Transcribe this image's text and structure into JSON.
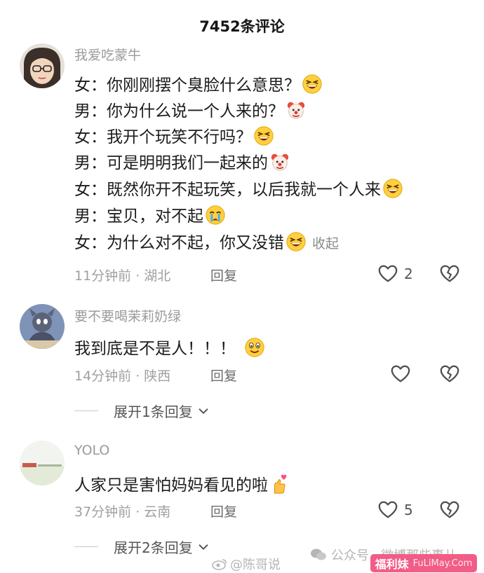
{
  "header": {
    "title": "7452条评论"
  },
  "comments": [
    {
      "username": "我爱吃蒙牛",
      "lines": [
        "女：你刚刚摆个臭脸什么意思？",
        "男：你为什么说一个人来的？",
        "女：我开个玩笑不行吗？",
        "男：可是明明我们一起来的",
        "女：既然你开不起玩笑，以后我就一个人来",
        "男：宝贝，对不起",
        "女：为什么对不起，你又没错"
      ],
      "collapse_label": "收起",
      "meta": "11分钟前 · 湖北",
      "reply_label": "回复",
      "like_count": "2"
    },
    {
      "username": "要不要喝茉莉奶绿",
      "lines": [
        "我到底是不是人！！！"
      ],
      "meta": "14分钟前 · 陕西",
      "reply_label": "回复",
      "expand_label": "展开1条回复"
    },
    {
      "username": "YOLO",
      "lines": [
        "人家只是害怕妈妈看见的啦"
      ],
      "meta": "37分钟前 · 云南",
      "reply_label": "回复",
      "like_count": "5",
      "expand_label": "展开2条回复"
    }
  ],
  "watermarks": {
    "weibo": "@陈哥说",
    "wechat": "公众号 · 微博那些事儿",
    "badge_cn": "福利妹",
    "badge_en": "FuLiMay.Com"
  },
  "icons": {
    "laugh": "grinning-squint-face-icon",
    "clown": "clown-face-icon",
    "cry": "crying-face-icon",
    "grin": "grinning-face-icon",
    "heart_hand": "finger-heart-icon",
    "like": "heart-outline-icon",
    "dislike": "broken-heart-icon"
  },
  "colors": {
    "username": "#9b9b9b",
    "meta": "#a0a0a0",
    "badge": "#f15d86"
  }
}
